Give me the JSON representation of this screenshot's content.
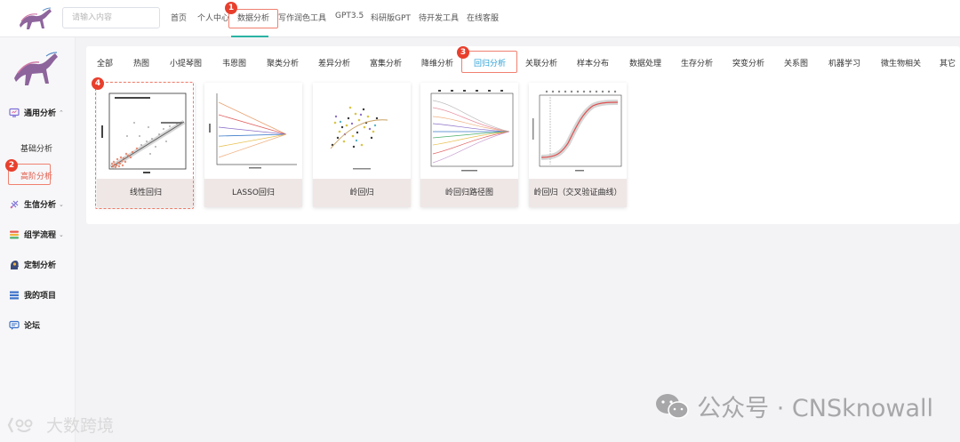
{
  "header": {
    "search_placeholder": "请输入内容",
    "nav": [
      "首页",
      "个人中心",
      "数据分析",
      "写作润色工具",
      "GPT3.5",
      "科研版GPT",
      "待开发工具",
      "在线客服"
    ],
    "active_nav": "数据分析"
  },
  "sidebar": {
    "groups": [
      {
        "label": "通用分析",
        "icon": "monitor-icon",
        "expanded": true,
        "children": [
          "基础分析",
          "高阶分析"
        ]
      },
      {
        "label": "生信分析",
        "icon": "dna-icon"
      },
      {
        "label": "组学流程",
        "icon": "layers-icon"
      },
      {
        "label": "定制分析",
        "icon": "head-gear-icon"
      },
      {
        "label": "我的项目",
        "icon": "list-icon"
      },
      {
        "label": "论坛",
        "icon": "chat-icon"
      }
    ],
    "active_child": "高阶分析"
  },
  "categories": [
    "全部",
    "热图",
    "小提琴图",
    "韦恩图",
    "聚类分析",
    "差异分析",
    "富集分析",
    "降维分析",
    "回归分析",
    "关联分析",
    "样本分布",
    "数据处理",
    "生存分析",
    "突变分析",
    "关系图",
    "机器学习",
    "微生物相关",
    "其它"
  ],
  "active_category": "回归分析",
  "cards": [
    {
      "label": "线性回归"
    },
    {
      "label": "LASSO回归"
    },
    {
      "label": "岭回归"
    },
    {
      "label": "岭回归路径图"
    },
    {
      "label": "岭回归（交叉验证曲线）"
    }
  ],
  "annotations": [
    "1",
    "2",
    "3",
    "4"
  ],
  "watermark": {
    "right": "公众号 · CNSknowall",
    "left": "大数跨境"
  },
  "colors": {
    "accent_teal": "#2bb3a3",
    "active_blue": "#2a9fd6",
    "annotation_red": "#e83f2d",
    "card_label_bg": "#efe7e6"
  }
}
